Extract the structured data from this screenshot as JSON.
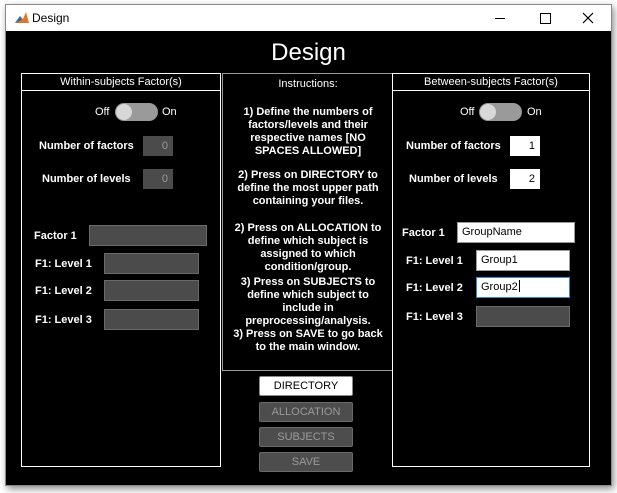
{
  "window": {
    "title": "Design",
    "heading": "Design"
  },
  "within": {
    "title": "Within-subjects Factor(s)",
    "toggle_off": "Off",
    "toggle_on": "On",
    "num_factors_label": "Number of factors",
    "num_factors_value": "0",
    "num_levels_label": "Number of levels",
    "num_levels_value": "0",
    "factor1_label": "Factor 1",
    "factor1_value": "",
    "levels": [
      {
        "label": "F1: Level 1",
        "value": ""
      },
      {
        "label": "F1: Level 2",
        "value": ""
      },
      {
        "label": "F1: Level 3",
        "value": ""
      }
    ]
  },
  "instructions": {
    "title": "Instructions:",
    "items": [
      "1) Define the numbers of factors/levels and their respective names  [NO SPACES ALLOWED]",
      "2) Press on DIRECTORY to define the most upper path containing your files.",
      "2) Press on ALLOCATION to define which subject is assigned to which condition/group.",
      "3) Press on SUBJECTS to define which subject to include in preprocessing/analysis.",
      "3) Press on SAVE to go back to the main window."
    ]
  },
  "buttons": {
    "directory": "DIRECTORY",
    "allocation": "ALLOCATION",
    "subjects": "SUBJECTS",
    "save": "SAVE"
  },
  "between": {
    "title": "Between-subjects Factor(s)",
    "toggle_off": "Off",
    "toggle_on": "On",
    "num_factors_label": "Number of factors",
    "num_factors_value": "1",
    "num_levels_label": "Number of levels",
    "num_levels_value": "2",
    "factor1_label": "Factor 1",
    "factor1_value": "GroupName",
    "levels": [
      {
        "label": "F1: Level 1",
        "value": "Group1"
      },
      {
        "label": "F1: Level 2",
        "value": "Group2"
      },
      {
        "label": "F1: Level 3",
        "value": ""
      }
    ]
  }
}
